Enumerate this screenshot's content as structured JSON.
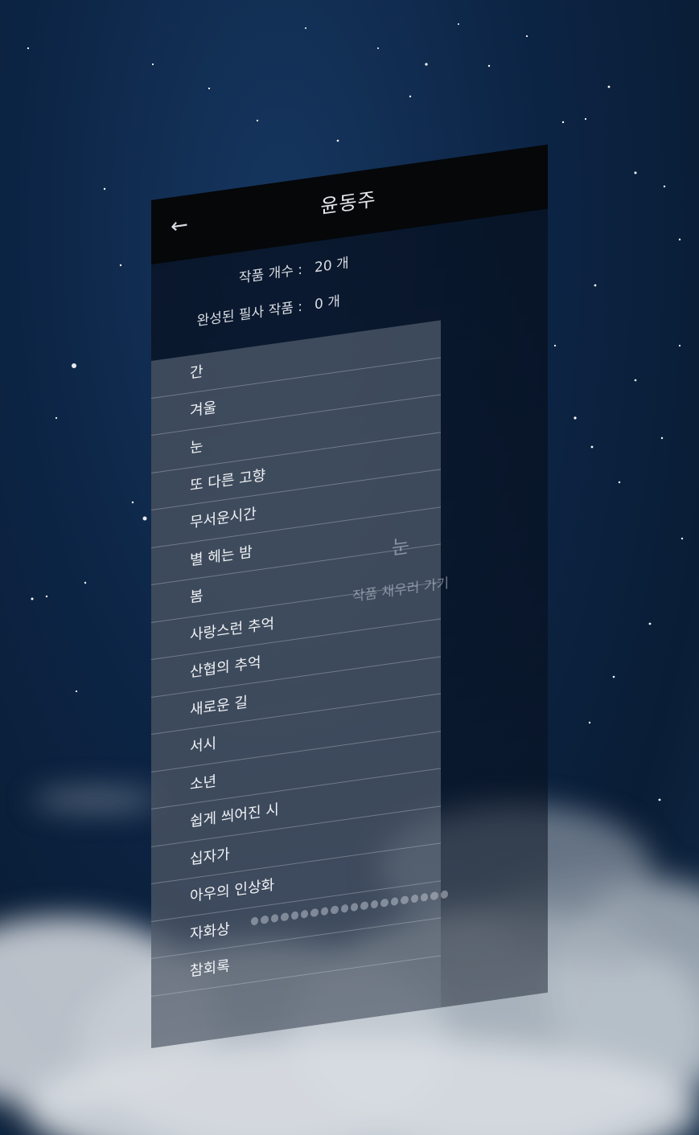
{
  "header": {
    "back_icon": "arrow-left-icon",
    "title": "윤동주"
  },
  "stats": {
    "works_label": "작품 개수 :",
    "works_value": "20 개",
    "completed_label": "완성된 필사 작품 :",
    "completed_value": "0 개"
  },
  "poems": [
    "간",
    "겨울",
    "눈",
    "또 다른 고향",
    "무서운시간",
    "별 헤는 밤",
    "봄",
    "사랑스런 추억",
    "산협의 추억",
    "새로운 길",
    "서시",
    "소년",
    "쉽게 씌어진 시",
    "십자가",
    "아우의 인상화",
    "자화상",
    "참회록"
  ],
  "detail": {
    "title": "눈",
    "action": "작품 채우러 가기"
  },
  "colors": {
    "topbar": "#050709",
    "text": "#f0f2f5",
    "sky": "#0c2444"
  }
}
